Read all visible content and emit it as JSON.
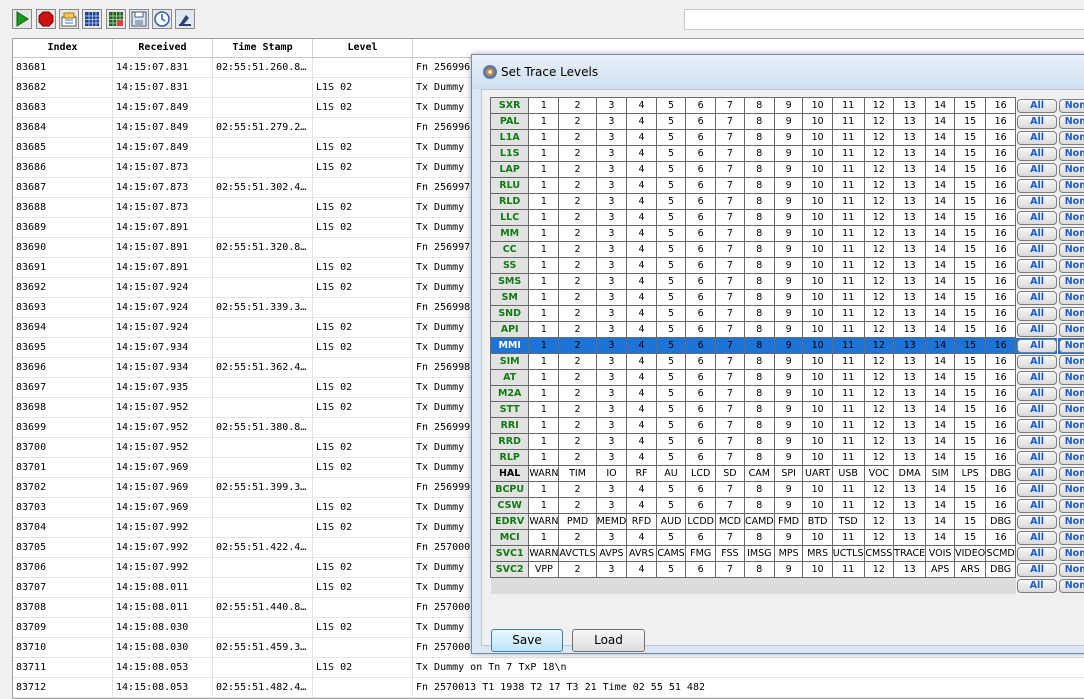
{
  "toolbar": {
    "buttons": [
      {
        "icon": "play-icon"
      },
      {
        "icon": "stop-icon"
      },
      {
        "icon": "clear-icon"
      },
      {
        "icon": "grid-icon"
      },
      {
        "icon": "filter-grid-icon"
      },
      {
        "icon": "save-icon"
      },
      {
        "icon": "clock-icon"
      },
      {
        "icon": "trace-config-icon"
      }
    ],
    "search_value": ""
  },
  "log": {
    "headers": [
      "Index",
      "Received",
      "Time Stamp",
      "Level",
      ""
    ],
    "rows": [
      [
        "83681",
        "14:15:07.831",
        "02:55:51.260.8…",
        "",
        "Fn 256996"
      ],
      [
        "83682",
        "14:15:07.831",
        "",
        "L1S 02",
        "Tx Dummy"
      ],
      [
        "83683",
        "14:15:07.849",
        "",
        "L1S 02",
        "Tx Dummy"
      ],
      [
        "83684",
        "14:15:07.849",
        "02:55:51.279.2…",
        "",
        "Fn 256996"
      ],
      [
        "83685",
        "14:15:07.849",
        "",
        "L1S 02",
        "Tx Dummy"
      ],
      [
        "83686",
        "14:15:07.873",
        "",
        "L1S 02",
        "Tx Dummy"
      ],
      [
        "83687",
        "14:15:07.873",
        "02:55:51.302.4…",
        "",
        "Fn 256997"
      ],
      [
        "83688",
        "14:15:07.873",
        "",
        "L1S 02",
        "Tx Dummy"
      ],
      [
        "83689",
        "14:15:07.891",
        "",
        "L1S 02",
        "Tx Dummy"
      ],
      [
        "83690",
        "14:15:07.891",
        "02:55:51.320.8…",
        "",
        "Fn 256997"
      ],
      [
        "83691",
        "14:15:07.891",
        "",
        "L1S 02",
        "Tx Dummy"
      ],
      [
        "83692",
        "14:15:07.924",
        "",
        "L1S 02",
        "Tx Dummy"
      ],
      [
        "83693",
        "14:15:07.924",
        "02:55:51.339.3…",
        "",
        "Fn 256998"
      ],
      [
        "83694",
        "14:15:07.924",
        "",
        "L1S 02",
        "Tx Dummy"
      ],
      [
        "83695",
        "14:15:07.934",
        "",
        "L1S 02",
        "Tx Dummy"
      ],
      [
        "83696",
        "14:15:07.934",
        "02:55:51.362.4…",
        "",
        "Fn 256998"
      ],
      [
        "83697",
        "14:15:07.935",
        "",
        "L1S 02",
        "Tx Dummy"
      ],
      [
        "83698",
        "14:15:07.952",
        "",
        "L1S 02",
        "Tx Dummy"
      ],
      [
        "83699",
        "14:15:07.952",
        "02:55:51.380.8…",
        "",
        "Fn 256999"
      ],
      [
        "83700",
        "14:15:07.952",
        "",
        "L1S 02",
        "Tx Dummy"
      ],
      [
        "83701",
        "14:15:07.969",
        "",
        "L1S 02",
        "Tx Dummy"
      ],
      [
        "83702",
        "14:15:07.969",
        "02:55:51.399.3…",
        "",
        "Fn 256999"
      ],
      [
        "83703",
        "14:15:07.969",
        "",
        "L1S 02",
        "Tx Dummy"
      ],
      [
        "83704",
        "14:15:07.992",
        "",
        "L1S 02",
        "Tx Dummy"
      ],
      [
        "83705",
        "14:15:07.992",
        "02:55:51.422.4…",
        "",
        "Fn 257000"
      ],
      [
        "83706",
        "14:15:07.992",
        "",
        "L1S 02",
        "Tx Dummy"
      ],
      [
        "83707",
        "14:15:08.011",
        "",
        "L1S 02",
        "Tx Dummy"
      ],
      [
        "83708",
        "14:15:08.011",
        "02:55:51.440.8…",
        "",
        "Fn 257000"
      ],
      [
        "83709",
        "14:15:08.030",
        "",
        "L1S 02",
        "Tx Dummy"
      ],
      [
        "83710",
        "14:15:08.030",
        "02:55:51.459.3…",
        "",
        "Fn 257000"
      ],
      [
        "83711",
        "14:15:08.053",
        "",
        "L1S 02",
        "Tx Dummy on Tn 7 TxP 18\\n"
      ],
      [
        "83712",
        "14:15:08.053",
        "02:55:51.482.4…",
        "",
        "Fn 2570013 T1 1938 T2 17 T3 21 Time 02 55 51 482"
      ]
    ]
  },
  "dialog": {
    "title": "Set Trace Levels",
    "all_label": "All",
    "none_label": "None",
    "selected_row": "MMI",
    "rows": [
      {
        "name": "SXR",
        "cells": [
          "1",
          "2",
          "3",
          "4",
          "5",
          "6",
          "7",
          "8",
          "9",
          "10",
          "11",
          "12",
          "13",
          "14",
          "15",
          "16"
        ]
      },
      {
        "name": "PAL",
        "cells": [
          "1",
          "2",
          "3",
          "4",
          "5",
          "6",
          "7",
          "8",
          "9",
          "10",
          "11",
          "12",
          "13",
          "14",
          "15",
          "16"
        ]
      },
      {
        "name": "L1A",
        "cells": [
          "1",
          "2",
          "3",
          "4",
          "5",
          "6",
          "7",
          "8",
          "9",
          "10",
          "11",
          "12",
          "13",
          "14",
          "15",
          "16"
        ]
      },
      {
        "name": "L1S",
        "cells": [
          "1",
          "2",
          "3",
          "4",
          "5",
          "6",
          "7",
          "8",
          "9",
          "10",
          "11",
          "12",
          "13",
          "14",
          "15",
          "16"
        ]
      },
      {
        "name": "LAP",
        "cells": [
          "1",
          "2",
          "3",
          "4",
          "5",
          "6",
          "7",
          "8",
          "9",
          "10",
          "11",
          "12",
          "13",
          "14",
          "15",
          "16"
        ]
      },
      {
        "name": "RLU",
        "cells": [
          "1",
          "2",
          "3",
          "4",
          "5",
          "6",
          "7",
          "8",
          "9",
          "10",
          "11",
          "12",
          "13",
          "14",
          "15",
          "16"
        ]
      },
      {
        "name": "RLD",
        "cells": [
          "1",
          "2",
          "3",
          "4",
          "5",
          "6",
          "7",
          "8",
          "9",
          "10",
          "11",
          "12",
          "13",
          "14",
          "15",
          "16"
        ]
      },
      {
        "name": "LLC",
        "cells": [
          "1",
          "2",
          "3",
          "4",
          "5",
          "6",
          "7",
          "8",
          "9",
          "10",
          "11",
          "12",
          "13",
          "14",
          "15",
          "16"
        ]
      },
      {
        "name": "MM",
        "cells": [
          "1",
          "2",
          "3",
          "4",
          "5",
          "6",
          "7",
          "8",
          "9",
          "10",
          "11",
          "12",
          "13",
          "14",
          "15",
          "16"
        ]
      },
      {
        "name": "CC",
        "cells": [
          "1",
          "2",
          "3",
          "4",
          "5",
          "6",
          "7",
          "8",
          "9",
          "10",
          "11",
          "12",
          "13",
          "14",
          "15",
          "16"
        ]
      },
      {
        "name": "SS",
        "cells": [
          "1",
          "2",
          "3",
          "4",
          "5",
          "6",
          "7",
          "8",
          "9",
          "10",
          "11",
          "12",
          "13",
          "14",
          "15",
          "16"
        ]
      },
      {
        "name": "SMS",
        "cells": [
          "1",
          "2",
          "3",
          "4",
          "5",
          "6",
          "7",
          "8",
          "9",
          "10",
          "11",
          "12",
          "13",
          "14",
          "15",
          "16"
        ]
      },
      {
        "name": "SM",
        "cells": [
          "1",
          "2",
          "3",
          "4",
          "5",
          "6",
          "7",
          "8",
          "9",
          "10",
          "11",
          "12",
          "13",
          "14",
          "15",
          "16"
        ]
      },
      {
        "name": "SND",
        "cells": [
          "1",
          "2",
          "3",
          "4",
          "5",
          "6",
          "7",
          "8",
          "9",
          "10",
          "11",
          "12",
          "13",
          "14",
          "15",
          "16"
        ]
      },
      {
        "name": "API",
        "cells": [
          "1",
          "2",
          "3",
          "4",
          "5",
          "6",
          "7",
          "8",
          "9",
          "10",
          "11",
          "12",
          "13",
          "14",
          "15",
          "16"
        ]
      },
      {
        "name": "MMI",
        "cells": [
          "1",
          "2",
          "3",
          "4",
          "5",
          "6",
          "7",
          "8",
          "9",
          "10",
          "11",
          "12",
          "13",
          "14",
          "15",
          "16"
        ]
      },
      {
        "name": "SIM",
        "cells": [
          "1",
          "2",
          "3",
          "4",
          "5",
          "6",
          "7",
          "8",
          "9",
          "10",
          "11",
          "12",
          "13",
          "14",
          "15",
          "16"
        ]
      },
      {
        "name": "AT",
        "cells": [
          "1",
          "2",
          "3",
          "4",
          "5",
          "6",
          "7",
          "8",
          "9",
          "10",
          "11",
          "12",
          "13",
          "14",
          "15",
          "16"
        ]
      },
      {
        "name": "M2A",
        "cells": [
          "1",
          "2",
          "3",
          "4",
          "5",
          "6",
          "7",
          "8",
          "9",
          "10",
          "11",
          "12",
          "13",
          "14",
          "15",
          "16"
        ]
      },
      {
        "name": "STT",
        "cells": [
          "1",
          "2",
          "3",
          "4",
          "5",
          "6",
          "7",
          "8",
          "9",
          "10",
          "11",
          "12",
          "13",
          "14",
          "15",
          "16"
        ]
      },
      {
        "name": "RRI",
        "cells": [
          "1",
          "2",
          "3",
          "4",
          "5",
          "6",
          "7",
          "8",
          "9",
          "10",
          "11",
          "12",
          "13",
          "14",
          "15",
          "16"
        ]
      },
      {
        "name": "RRD",
        "cells": [
          "1",
          "2",
          "3",
          "4",
          "5",
          "6",
          "7",
          "8",
          "9",
          "10",
          "11",
          "12",
          "13",
          "14",
          "15",
          "16"
        ]
      },
      {
        "name": "RLP",
        "cells": [
          "1",
          "2",
          "3",
          "4",
          "5",
          "6",
          "7",
          "8",
          "9",
          "10",
          "11",
          "12",
          "13",
          "14",
          "15",
          "16"
        ]
      },
      {
        "name": "HAL",
        "cells": [
          "WARN",
          "TIM",
          "IO",
          "RF",
          "AU",
          "LCD",
          "SD",
          "CAM",
          "SPI",
          "UART",
          "USB",
          "VOC",
          "DMA",
          "SIM",
          "LPS",
          "DBG"
        ]
      },
      {
        "name": "BCPU",
        "cells": [
          "1",
          "2",
          "3",
          "4",
          "5",
          "6",
          "7",
          "8",
          "9",
          "10",
          "11",
          "12",
          "13",
          "14",
          "15",
          "16"
        ]
      },
      {
        "name": "CSW",
        "cells": [
          "1",
          "2",
          "3",
          "4",
          "5",
          "6",
          "7",
          "8",
          "9",
          "10",
          "11",
          "12",
          "13",
          "14",
          "15",
          "16"
        ]
      },
      {
        "name": "EDRV",
        "cells": [
          "WARN",
          "PMD",
          "MEMD",
          "RFD",
          "AUD",
          "LCDD",
          "MCD",
          "CAMD",
          "FMD",
          "BTD",
          "TSD",
          "12",
          "13",
          "14",
          "15",
          "DBG"
        ]
      },
      {
        "name": "MCI",
        "cells": [
          "1",
          "2",
          "3",
          "4",
          "5",
          "6",
          "7",
          "8",
          "9",
          "10",
          "11",
          "12",
          "13",
          "14",
          "15",
          "16"
        ]
      },
      {
        "name": "SVC1",
        "cells": [
          "WARN",
          "AVCTLS",
          "AVPS",
          "AVRS",
          "CAMS",
          "FMG",
          "FSS",
          "IMSG",
          "MPS",
          "MRS",
          "UCTLS",
          "CMSS",
          "TRACE",
          "VOIS",
          "VIDEO",
          "SCMD"
        ]
      },
      {
        "name": "SVC2",
        "cells": [
          "VPP",
          "2",
          "3",
          "4",
          "5",
          "6",
          "7",
          "8",
          "9",
          "10",
          "11",
          "12",
          "13",
          "APS",
          "ARS",
          "DBG"
        ]
      }
    ],
    "save_label": "Save",
    "load_label": "Load"
  }
}
